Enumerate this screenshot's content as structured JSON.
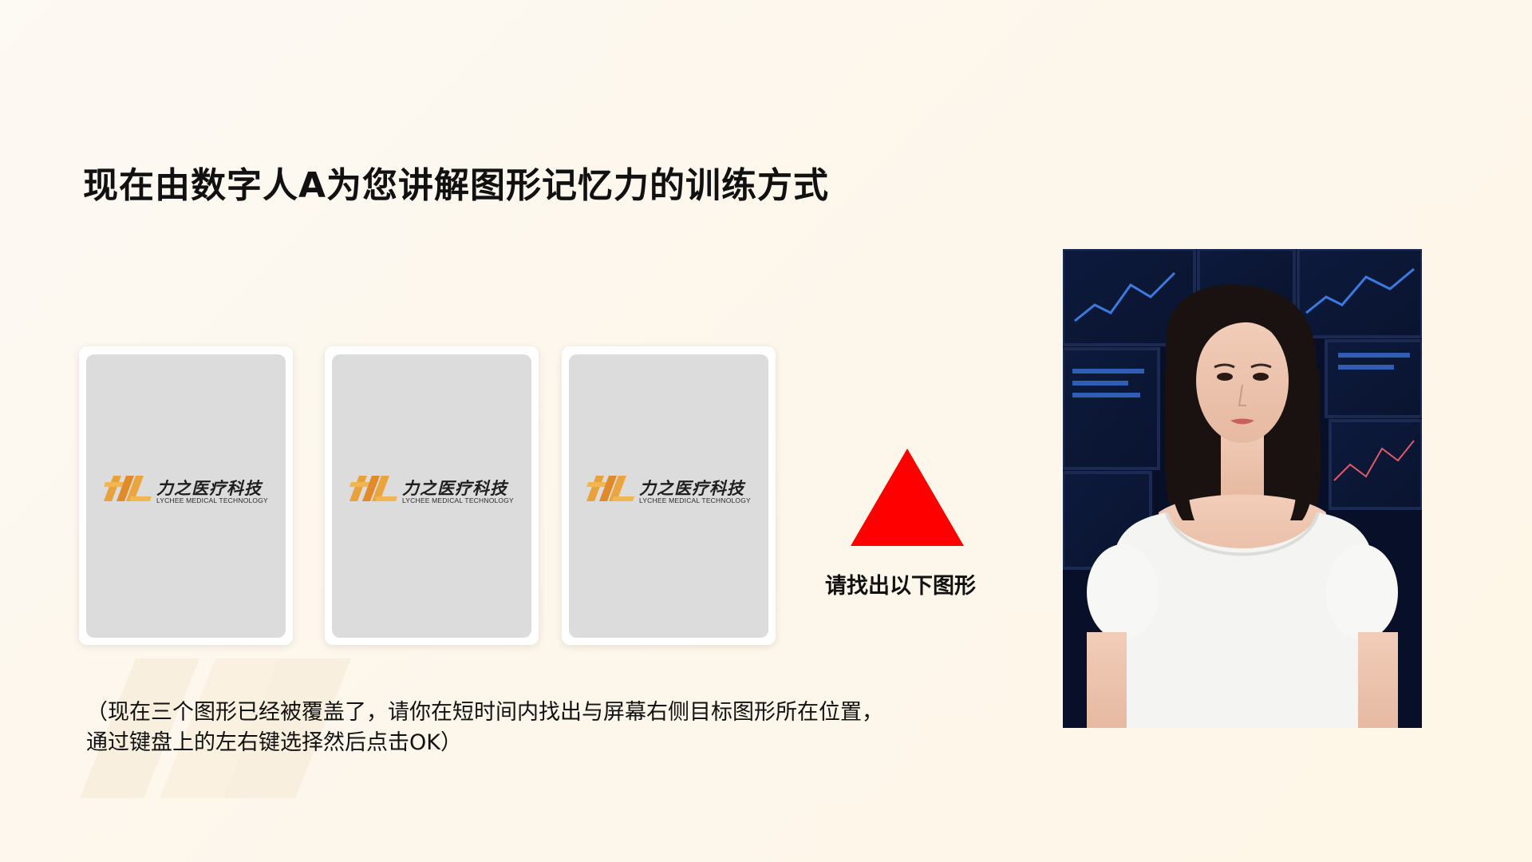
{
  "title": "现在由数字人A为您讲解图形记忆力的训练方式",
  "cards": [
    {
      "logo_cn": "力之医疗科技",
      "logo_en": "LYCHEE MEDICAL TECHNOLOGY"
    },
    {
      "logo_cn": "力之医疗科技",
      "logo_en": "LYCHEE MEDICAL TECHNOLOGY"
    },
    {
      "logo_cn": "力之医疗科技",
      "logo_en": "LYCHEE MEDICAL TECHNOLOGY"
    }
  ],
  "target": {
    "shape": "triangle-icon",
    "color": "#ff0000",
    "label": "请找出以下图形"
  },
  "instructions": {
    "line1": "（现在三个图形已经被覆盖了，请你在短时间内找出与屏幕右侧目标图形所在位置，",
    "line2": "通过键盘上的左右键选择然后点击OK）"
  },
  "presenter": {
    "icon": "digital-presenter-avatar"
  },
  "colors": {
    "background": "#fdf8f0",
    "card_cover": "#dcdcdc",
    "logo_orange": "#e9a23b",
    "target_red": "#ff0000"
  }
}
